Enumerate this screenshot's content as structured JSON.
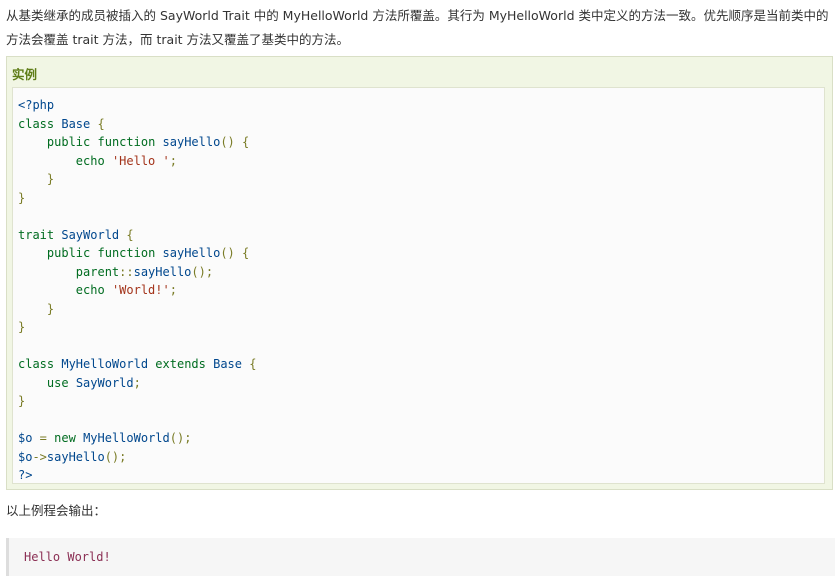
{
  "intro": {
    "text": "从基类继承的成员被插入的 SayWorld Trait 中的 MyHelloWorld 方法所覆盖。其行为 MyHelloWorld 类中定义的方法一致。优先顺序是当前类中的方法会覆盖 trait 方法，而 trait 方法又覆盖了基类中的方法。"
  },
  "example": {
    "title": "实例",
    "code_lines": [
      [
        {
          "t": "<?php",
          "c": "tag"
        }
      ],
      [
        {
          "t": "class",
          "c": "kw"
        },
        {
          "t": " "
        },
        {
          "t": "Base",
          "c": "cls"
        },
        {
          "t": " {",
          "c": "pun"
        }
      ],
      [
        {
          "t": "    "
        },
        {
          "t": "public",
          "c": "kw"
        },
        {
          "t": " "
        },
        {
          "t": "function",
          "c": "kw"
        },
        {
          "t": " "
        },
        {
          "t": "sayHello",
          "c": "fn"
        },
        {
          "t": "() {",
          "c": "pun"
        }
      ],
      [
        {
          "t": "        "
        },
        {
          "t": "echo",
          "c": "kw"
        },
        {
          "t": " "
        },
        {
          "t": "'Hello '",
          "c": "str"
        },
        {
          "t": ";",
          "c": "pun"
        }
      ],
      [
        {
          "t": "    "
        },
        {
          "t": "}",
          "c": "pun"
        }
      ],
      [
        {
          "t": "}",
          "c": "pun"
        }
      ],
      [],
      [
        {
          "t": "trait",
          "c": "kw"
        },
        {
          "t": " "
        },
        {
          "t": "SayWorld",
          "c": "cls"
        },
        {
          "t": " {",
          "c": "pun"
        }
      ],
      [
        {
          "t": "    "
        },
        {
          "t": "public",
          "c": "kw"
        },
        {
          "t": " "
        },
        {
          "t": "function",
          "c": "kw"
        },
        {
          "t": " "
        },
        {
          "t": "sayHello",
          "c": "fn"
        },
        {
          "t": "() {",
          "c": "pun"
        }
      ],
      [
        {
          "t": "        "
        },
        {
          "t": "parent",
          "c": "kw"
        },
        {
          "t": "::",
          "c": "pun"
        },
        {
          "t": "sayHello",
          "c": "fn"
        },
        {
          "t": "();",
          "c": "pun"
        }
      ],
      [
        {
          "t": "        "
        },
        {
          "t": "echo",
          "c": "kw"
        },
        {
          "t": " "
        },
        {
          "t": "'World!'",
          "c": "str"
        },
        {
          "t": ";",
          "c": "pun"
        }
      ],
      [
        {
          "t": "    "
        },
        {
          "t": "}",
          "c": "pun"
        }
      ],
      [
        {
          "t": "}",
          "c": "pun"
        }
      ],
      [],
      [
        {
          "t": "class",
          "c": "kw"
        },
        {
          "t": " "
        },
        {
          "t": "MyHelloWorld",
          "c": "cls"
        },
        {
          "t": " "
        },
        {
          "t": "extends",
          "c": "kw"
        },
        {
          "t": " "
        },
        {
          "t": "Base",
          "c": "cls"
        },
        {
          "t": " {",
          "c": "pun"
        }
      ],
      [
        {
          "t": "    "
        },
        {
          "t": "use",
          "c": "kw"
        },
        {
          "t": " "
        },
        {
          "t": "SayWorld",
          "c": "cls"
        },
        {
          "t": ";",
          "c": "pun"
        }
      ],
      [
        {
          "t": "}",
          "c": "pun"
        }
      ],
      [],
      [
        {
          "t": "$o",
          "c": "var"
        },
        {
          "t": " = ",
          "c": "pun"
        },
        {
          "t": "new",
          "c": "kw"
        },
        {
          "t": " "
        },
        {
          "t": "MyHelloWorld",
          "c": "cls"
        },
        {
          "t": "();",
          "c": "pun"
        }
      ],
      [
        {
          "t": "$o",
          "c": "var"
        },
        {
          "t": "->",
          "c": "pun"
        },
        {
          "t": "sayHello",
          "c": "fn"
        },
        {
          "t": "();",
          "c": "pun"
        }
      ],
      [
        {
          "t": "?>",
          "c": "tag"
        }
      ]
    ]
  },
  "output": {
    "label": "以上例程会输出：",
    "text": "Hello World!"
  },
  "colors": {
    "title_green": "#5f7d18",
    "keyword": "#006c20",
    "identifier": "#00478d",
    "string": "#a3331a",
    "output_text": "#8b2f54"
  }
}
